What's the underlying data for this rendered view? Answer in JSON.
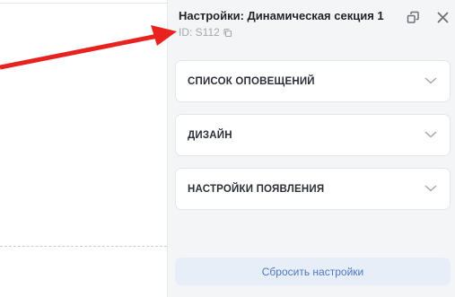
{
  "panel": {
    "title": "Настройки: Динамическая секция 1",
    "id_text": "ID: S112",
    "sections": [
      {
        "label": "СПИСОК ОПОВЕЩЕНИЙ"
      },
      {
        "label": "ДИЗАЙН"
      },
      {
        "label": "НАСТРОЙКИ ПОЯВЛЕНИЯ"
      }
    ],
    "reset_label": "Сбросить настройки"
  },
  "icons": {
    "copy": "copy-icon",
    "popout": "popout-icon",
    "close": "close-icon",
    "chevron": "chevron-down-icon"
  },
  "colors": {
    "annotation_arrow": "#e8231f",
    "reset_text": "#4a78c4",
    "reset_bg": "#e8eef8",
    "panel_bg": "#f4f5f7"
  }
}
